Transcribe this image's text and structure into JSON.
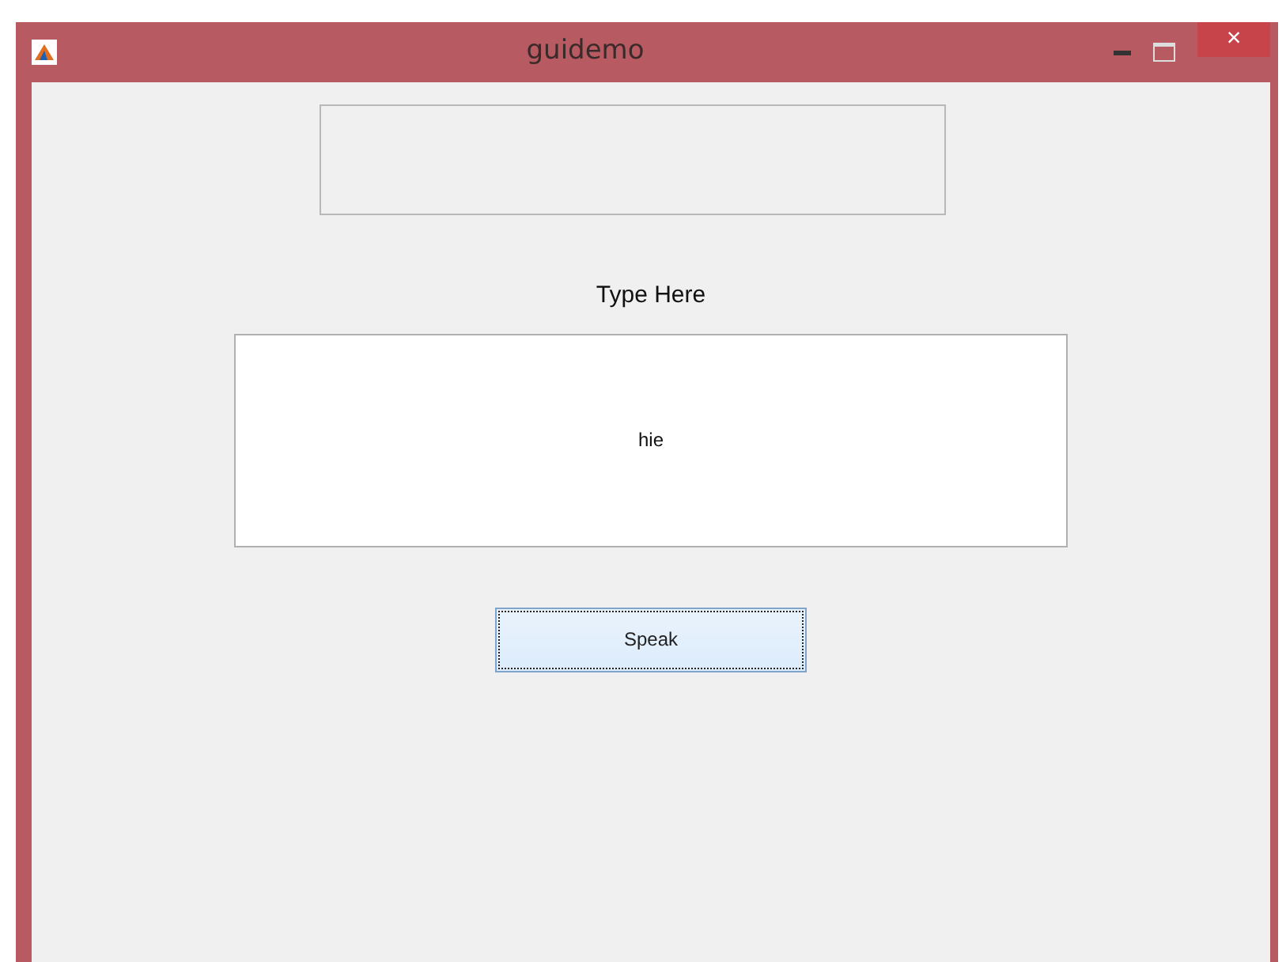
{
  "window": {
    "title": "guidemo",
    "close_glyph": "×"
  },
  "label": "Type Here",
  "input": {
    "value": "hie"
  },
  "button": {
    "label": "Speak",
    "focused": true
  }
}
